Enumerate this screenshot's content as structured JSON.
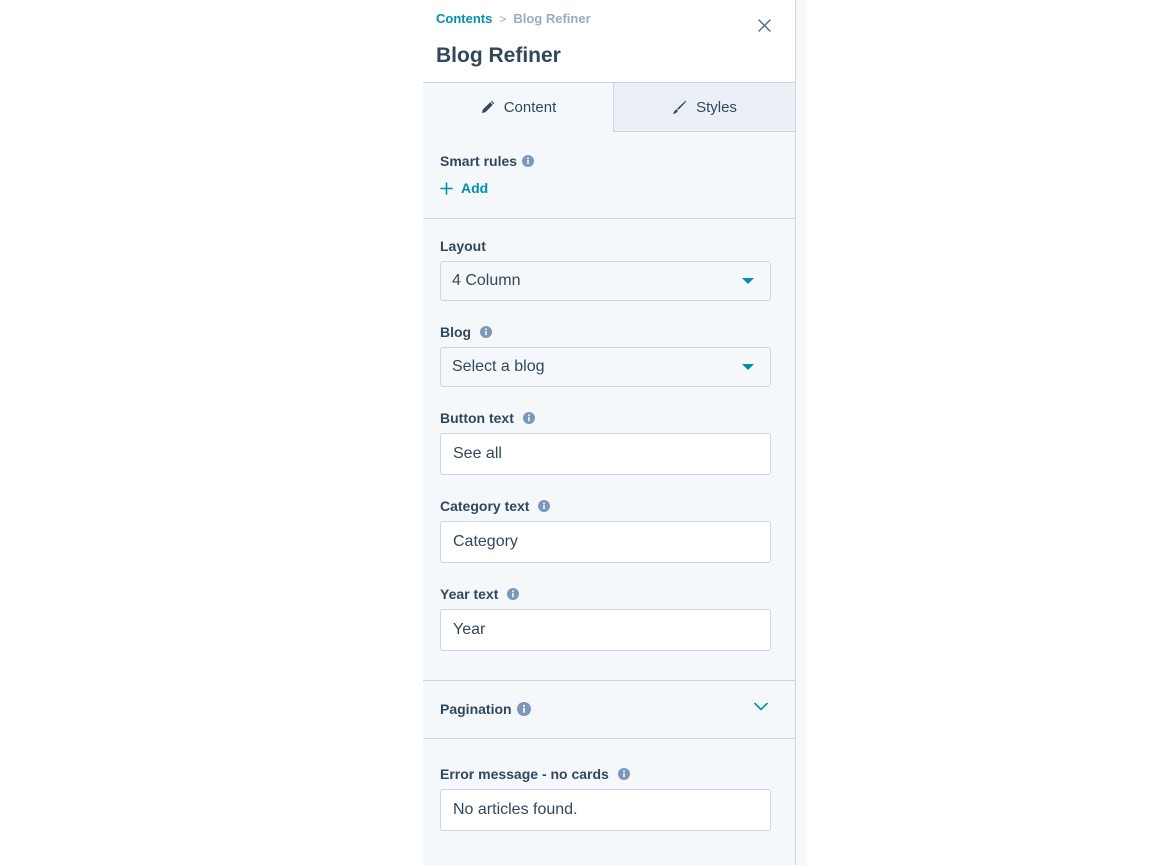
{
  "breadcrumb": {
    "parent": "Contents",
    "separator": ">",
    "current": "Blog Refiner"
  },
  "title": "Blog Refiner",
  "tabs": [
    {
      "label": "Content",
      "icon": "pencil-icon",
      "active": true
    },
    {
      "label": "Styles",
      "icon": "brush-icon",
      "active": false
    }
  ],
  "smart_rules": {
    "label": "Smart rules",
    "add_label": "Add"
  },
  "fields": {
    "layout": {
      "label": "Layout",
      "value": "4 Column"
    },
    "blog": {
      "label": "Blog",
      "value": "Select a blog"
    },
    "button_text": {
      "label": "Button text",
      "value": "See all"
    },
    "category_text": {
      "label": "Category text",
      "value": "Category"
    },
    "year_text": {
      "label": "Year text",
      "value": "Year"
    },
    "error_message": {
      "label": "Error message - no cards",
      "value": "No articles found."
    }
  },
  "pagination": {
    "label": "Pagination",
    "expanded": false
  },
  "colors": {
    "accent": "#0091ae",
    "text": "#33475b",
    "muted": "#99acc2",
    "border": "#cbd6e2",
    "panel_bg": "#f5f8fa",
    "inactive_tab_bg": "#eaf0f6",
    "info_icon": "#7c98b6"
  }
}
